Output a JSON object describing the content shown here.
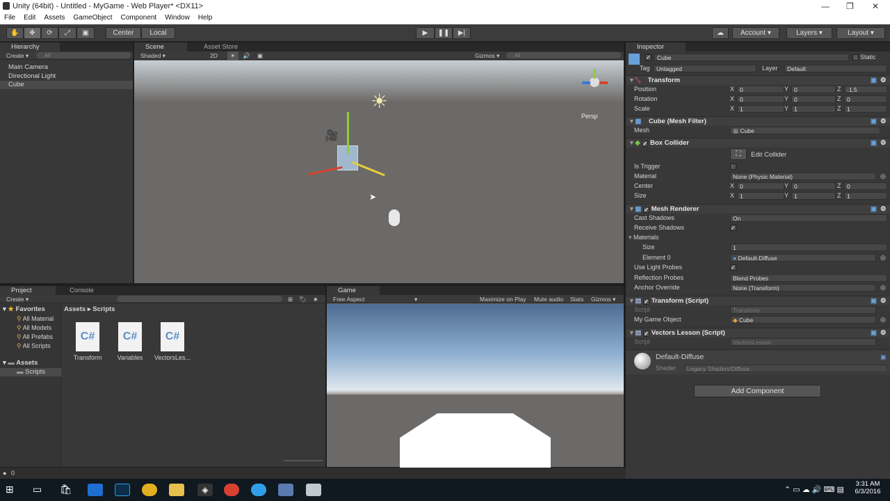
{
  "window": {
    "title": "Unity (64bit) - Untitled - MyGame - Web Player* <DX11>",
    "min": "—",
    "max": "❐",
    "close": "✕"
  },
  "menu": [
    "File",
    "Edit",
    "Assets",
    "GameObject",
    "Component",
    "Window",
    "Help"
  ],
  "toolbar": {
    "pivot": "Center",
    "space": "Local",
    "account": "Account",
    "layers": "Layers",
    "layout": "Layout"
  },
  "hierarchy": {
    "tab": "Hierarchy",
    "create": "Create",
    "search": "All",
    "items": [
      "Main Camera",
      "Directional Light",
      "Cube"
    ]
  },
  "scene": {
    "tab_scene": "Scene",
    "tab_store": "Asset Store",
    "shading": "Shaded",
    "mode2d": "2D",
    "gizmos": "Gizmos",
    "search": "All",
    "persp": "Persp"
  },
  "project": {
    "tab_project": "Project",
    "tab_console": "Console",
    "create": "Create",
    "favorites": "Favorites",
    "fav_items": [
      "All Material",
      "All Models",
      "All Prefabs",
      "All Scripts"
    ],
    "assets": "Assets",
    "scripts_folder": "Scripts",
    "breadcrumb_root": "Assets",
    "breadcrumb_sep": "▸",
    "breadcrumb_leaf": "Scripts",
    "files": [
      "Transform",
      "Variables",
      "VectorsLes..."
    ],
    "cs_label": "C#"
  },
  "status": {
    "count": "0"
  },
  "game": {
    "tab": "Game",
    "aspect": "Free Aspect",
    "maximize": "Maximize on Play",
    "mute": "Mute audio",
    "stats": "Stats",
    "gizmos": "Gizmos"
  },
  "inspector": {
    "tab": "Inspector",
    "object_name": "Cube",
    "static": "Static",
    "tag_label": "Tag",
    "tag_value": "Untagged",
    "layer_label": "Layer",
    "layer_value": "Default",
    "transform": {
      "title": "Transform",
      "position": {
        "label": "Position",
        "x": "0",
        "y": "0",
        "z": "-1.5"
      },
      "rotation": {
        "label": "Rotation",
        "x": "0",
        "y": "0",
        "z": "0"
      },
      "scale": {
        "label": "Scale",
        "x": "1",
        "y": "1",
        "z": "1"
      }
    },
    "mesh_filter": {
      "title": "Cube (Mesh Filter)",
      "mesh_label": "Mesh",
      "mesh_value": "Cube"
    },
    "box_collider": {
      "title": "Box Collider",
      "edit": "Edit Collider",
      "is_trigger": "Is Trigger",
      "material_label": "Material",
      "material_value": "None (Physic Material)",
      "center": {
        "label": "Center",
        "x": "0",
        "y": "0",
        "z": "0"
      },
      "size": {
        "label": "Size",
        "x": "1",
        "y": "1",
        "z": "1"
      }
    },
    "mesh_renderer": {
      "title": "Mesh Renderer",
      "cast_shadows": "Cast Shadows",
      "cast_value": "On",
      "receive_shadows": "Receive Shadows",
      "materials": "Materials",
      "size_label": "Size",
      "size_value": "1",
      "element_label": "Element 0",
      "element_value": "Default-Diffuse",
      "light_probes": "Use Light Probes",
      "reflection_label": "Reflection Probes",
      "reflection_value": "Blend Probes",
      "anchor_label": "Anchor Override",
      "anchor_value": "None (Transform)"
    },
    "transform_script": {
      "title": "Transform (Script)",
      "script_label": "Script",
      "script_value": "Transform",
      "go_label": "My Game Object",
      "go_value": "Cube"
    },
    "vectors_script": {
      "title": "Vectors Lesson (Script)",
      "script_label": "Script",
      "script_value": "VectorsLesson"
    },
    "material": {
      "name": "Default-Diffuse",
      "shader_label": "Shader",
      "shader_value": "Legacy Shaders/Diffuse"
    },
    "add_component": "Add Component",
    "x": "X",
    "y": "Y",
    "z": "Z"
  },
  "taskbar": {
    "time": "3:31 AM",
    "date": "6/3/2016"
  }
}
